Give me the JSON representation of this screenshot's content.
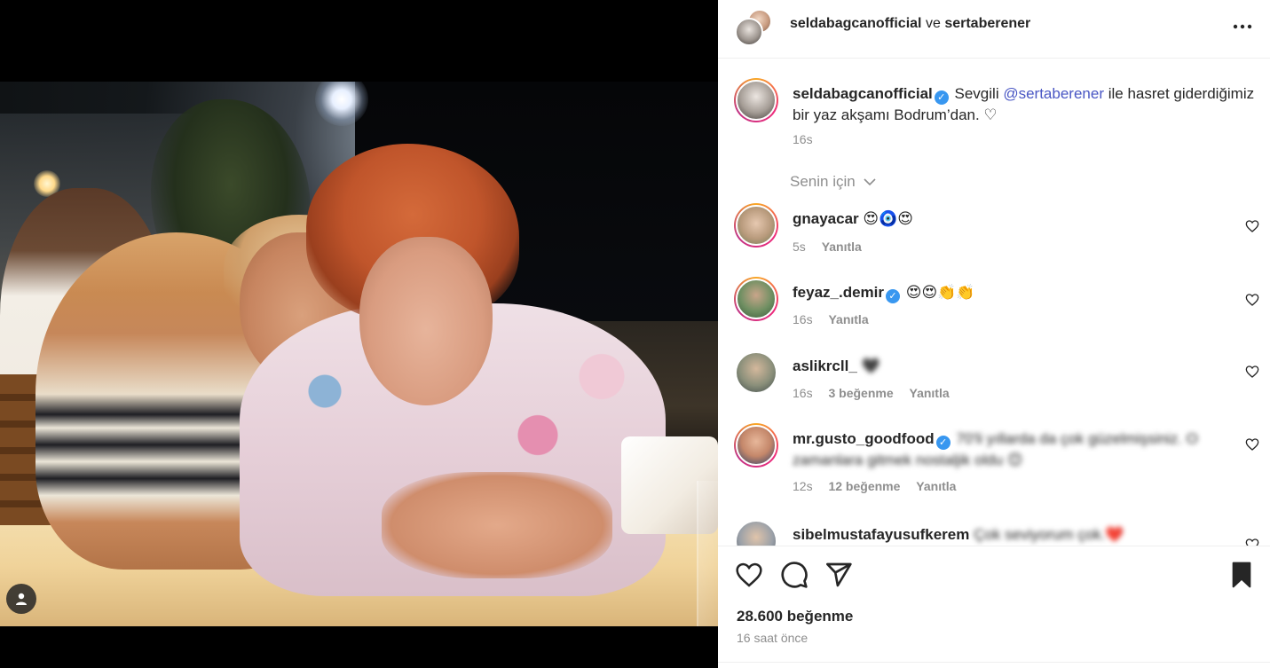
{
  "header": {
    "author": "seldabagcanofficial",
    "conjunction": "ve",
    "coauthor": "sertaberener",
    "more_icon": "more-horizontal-icon"
  },
  "caption": {
    "username": "seldabagcanofficial",
    "verified": true,
    "text_before": "Sevgili ",
    "mention": "@sertaberener",
    "text_after": " ile hasret giderdiğimiz bir yaz akşamı Bodrum’dan. ",
    "emoji": "♡",
    "time": "16s"
  },
  "filter_label": "Senin için",
  "comments": [
    {
      "username": "gnayacar",
      "verified": false,
      "text": "😍🧿😍",
      "time": "5s",
      "likes": "",
      "reply": "Yanıtla"
    },
    {
      "username": "feyaz_.demir",
      "verified": true,
      "text": "😍😍👏👏",
      "time": "16s",
      "likes": "",
      "reply": "Yanıtla"
    },
    {
      "username": "aslikrcll_",
      "verified": false,
      "text": "🖤",
      "time": "16s",
      "likes": "3 beğenme",
      "reply": "Yanıtla"
    },
    {
      "username": "mr.gusto_goodfood",
      "verified": true,
      "text": "70'li yıllarda da çok güzelmişsiniz. O zamanlara gitmek nostaljik oldu 😊",
      "time": "12s",
      "likes": "12 beğenme",
      "reply": "Yanıtla"
    },
    {
      "username": "sibelmustafayusufkerem",
      "verified": false,
      "text": "Çok seviyorum çok.❤️",
      "time": "",
      "likes": "",
      "reply": ""
    }
  ],
  "actions": {
    "like_icon": "heart-icon",
    "comment_icon": "comment-icon",
    "share_icon": "send-icon",
    "save_icon": "bookmark-icon"
  },
  "likes_count": "28.600 beğenme",
  "posted": "16 saat önce",
  "colors": {
    "text": "#262626",
    "muted": "#8e8e8e",
    "mention": "#4a57c4",
    "verified": "#3897f0",
    "story_ring": "#ee2a7b"
  }
}
